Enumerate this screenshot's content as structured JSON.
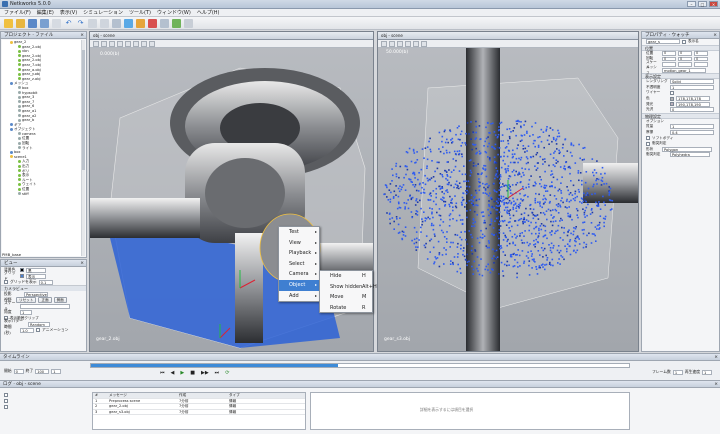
{
  "window": {
    "title": "Netkworks 5.0.0"
  },
  "menu": [
    "ファイル(F)",
    "編集(E)",
    "表示(V)",
    "シミュレーション",
    "ツール(T)",
    "ウィンドウ(W)",
    "ヘルプ(H)"
  ],
  "project_panel": {
    "title": "プロジェクト",
    "tab2": "ファイル"
  },
  "tree_items": [
    "gear_2",
    "gear_2.obj",
    "vbn",
    "gear_2.obj",
    "gear_2.obj",
    "gear_7.obj",
    "gear_a.obj",
    "gear_y.obj",
    "gear_z.obj",
    "メッシュ",
    "box",
    "hypsobit",
    "gear_3",
    "gear_7",
    "gear_6",
    "gear_a1",
    "gear_a2",
    "gear_b",
    "ギア",
    "オブジェクト",
    "camera",
    "位置",
    "回転",
    "ライト",
    "box",
    "scene1",
    "入力",
    "出力",
    "ボリ",
    "表示",
    "ルート",
    "ウェイト",
    "位置",
    "stiff"
  ],
  "tree_footer": "PMB_base",
  "view_panel": {
    "title": "ビュー",
    "bg_label": "背景色",
    "grid_label": "グリッド",
    "grid_val": "表示",
    "bg_val": "黒",
    "grid_check": "グリッドを表示",
    "grid_size": "0.1",
    "cam_title": "カメラビュー",
    "cam_type_label": "投影",
    "cam_type": "Perspective",
    "near_label": "視野",
    "reset_btn": "リセット",
    "front_btn": "正面",
    "side_btn": "側面",
    "scale_label": "スケール",
    "angle_label": "角度",
    "angle": "1",
    "fps_label": "表示パターン",
    "fps_val": "Random",
    "step_label": "時間(秒)",
    "step": "1.0",
    "anim_label": "アニメーション"
  },
  "viewport_left": {
    "tab": "obj - scene",
    "scale": "0.000(b)",
    "label": "gear_2.obj"
  },
  "viewport_right": {
    "tab": "obj - scene",
    "scale": "50.000(b)",
    "label": "gear_s3.obj"
  },
  "context_menu": {
    "items": [
      {
        "label": "Test",
        "sub": true
      },
      {
        "label": "View",
        "sub": true
      },
      {
        "label": "Playback",
        "sub": true
      },
      {
        "label": "Select",
        "sub": true
      },
      {
        "label": "Camera",
        "sub": true
      },
      {
        "label": "Object",
        "sub": true
      },
      {
        "label": "Add",
        "sub": true
      }
    ],
    "submenu": [
      {
        "label": "Hide",
        "shortcut": "H"
      },
      {
        "label": "Show hidden",
        "shortcut": "Alt+H"
      },
      {
        "label": "Move",
        "shortcut": "M"
      },
      {
        "label": "Rotate",
        "shortcut": "R"
      }
    ]
  },
  "inspector": {
    "title": "プロパティ",
    "tab2": "ウォッチ",
    "object_name": "gear_s",
    "object_field": "表示名",
    "sec_transform": "位置",
    "pos_label": "位置",
    "pos": [
      "0",
      "0",
      "0"
    ],
    "rot_label": "回転",
    "rot": [
      "0",
      "0",
      "0"
    ],
    "scale_label": "スケール",
    "mesh_label": "メッシュ",
    "mesh": "motion_gear_1",
    "sec_render": "表示設定",
    "render_label": "レンダリング",
    "render_val": "Solid",
    "opacity_label": "不透明度",
    "opacity": "1",
    "wire_label": "ワイヤー",
    "color_label": "色",
    "color1": "178,178,178",
    "color2": "190,178,190",
    "emit_label": "発光",
    "spec_label": "光沢",
    "spec": "0",
    "sec_sim": "物理設定",
    "opt_label": "オプション",
    "mass_label": "質量",
    "mass": "1",
    "fric_label": "摩擦",
    "fric": "0.4",
    "check1": "ソフトボディ",
    "check2": "衝突判定",
    "type_label": "形状",
    "type_val": "Polygon",
    "coll_label": "衝突判定",
    "coll_val": "Polyhedra"
  },
  "timeline": {
    "title": "タイムライン",
    "start_label": "開始",
    "start": "0",
    "end_label": "終了",
    "end": "100",
    "frame": "1",
    "fps_label": "フレーム数",
    "fps": "1",
    "speed_label": "再生速度",
    "speed": "1",
    "progress": 0.46
  },
  "log": {
    "title": "ログ",
    "tab2": "obj - scene",
    "headers": [
      "#",
      "メッセージ",
      "作成",
      "タイプ"
    ],
    "rows": [
      [
        "1",
        "Preprocess scene",
        "7分前",
        "情報"
      ],
      [
        "2",
        "gear_2.obj",
        "7分前",
        "情報"
      ],
      [
        "3",
        "gear_s3.obj",
        "7分前",
        "情報"
      ]
    ],
    "message": "詳細を表示するには項目を選択"
  }
}
